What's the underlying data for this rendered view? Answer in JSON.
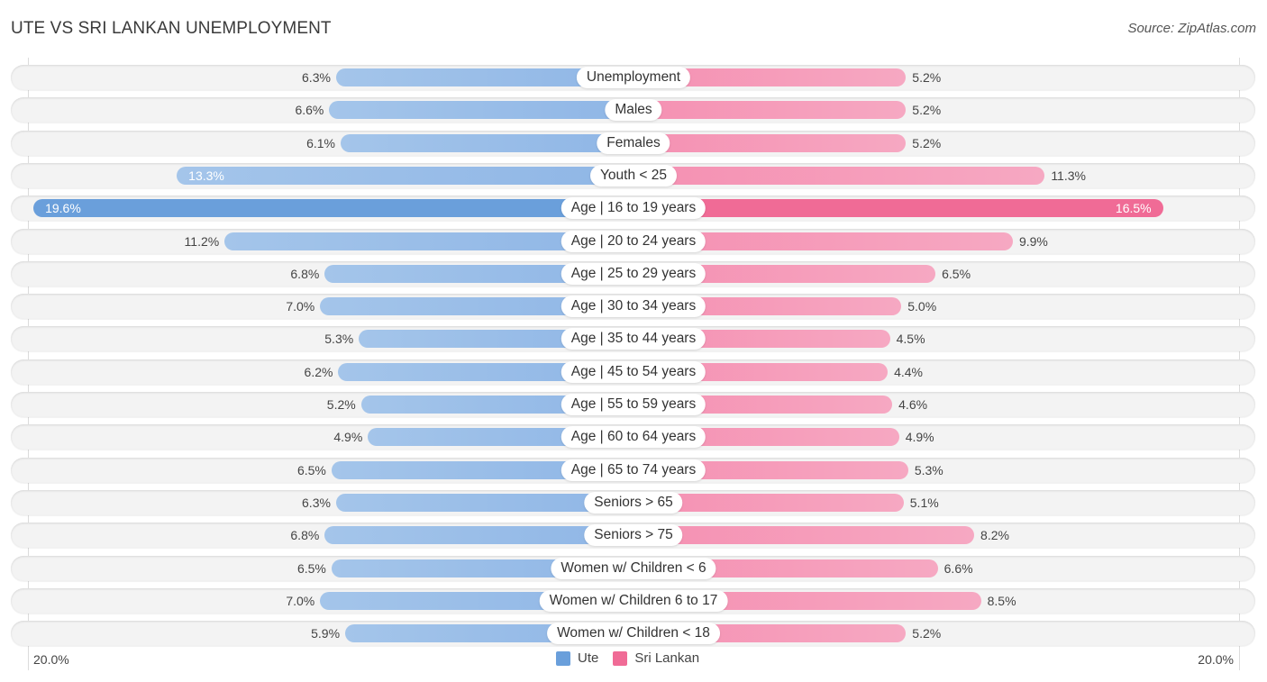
{
  "header": {
    "title": "UTE VS SRI LANKAN UNEMPLOYMENT",
    "source": "Source: ZipAtlas.com"
  },
  "colors": {
    "ute": "#6a9fdb",
    "ute_light": "#a4c5ea",
    "sri_lankan": "#f06b96",
    "sri_lankan_light": "#f6a8c2"
  },
  "chart_data": {
    "type": "bar",
    "orientation": "horizontal-diverging",
    "title": "UTE VS SRI LANKAN UNEMPLOYMENT",
    "xlim": [
      0,
      20.0
    ],
    "axis_left_label": "20.0%",
    "axis_right_label": "20.0%",
    "legend": [
      "Ute",
      "Sri Lankan"
    ],
    "legend_position": "bottom-center",
    "categories": [
      "Unemployment",
      "Males",
      "Females",
      "Youth < 25",
      "Age | 16 to 19 years",
      "Age | 20 to 24 years",
      "Age | 25 to 29 years",
      "Age | 30 to 34 years",
      "Age | 35 to 44 years",
      "Age | 45 to 54 years",
      "Age | 55 to 59 years",
      "Age | 60 to 64 years",
      "Age | 65 to 74 years",
      "Seniors > 65",
      "Seniors > 75",
      "Women w/ Children < 6",
      "Women w/ Children 6 to 17",
      "Women w/ Children < 18"
    ],
    "series": [
      {
        "name": "Ute",
        "values": [
          6.3,
          6.6,
          6.1,
          13.3,
          19.6,
          11.2,
          6.8,
          7.0,
          5.3,
          6.2,
          5.2,
          4.9,
          6.5,
          6.3,
          6.8,
          6.5,
          7.0,
          5.9
        ]
      },
      {
        "name": "Sri Lankan",
        "values": [
          5.2,
          5.2,
          5.2,
          11.3,
          16.5,
          9.9,
          6.5,
          5.0,
          4.5,
          4.4,
          4.6,
          4.9,
          5.3,
          5.1,
          8.2,
          6.6,
          8.5,
          5.2
        ]
      }
    ]
  }
}
